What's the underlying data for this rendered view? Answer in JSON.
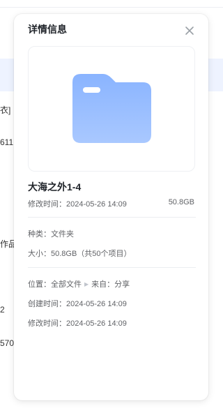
{
  "background": {
    "fragments": [
      "衣]",
      "611",
      "作品",
      "2",
      "570"
    ]
  },
  "panel": {
    "title": "详情信息",
    "file_name": "大海之外1-4",
    "modified_label": "修改时间：",
    "modified_value": "2024-05-26 14:09",
    "size_short": "50.8GB",
    "type_label": "种类：",
    "type_value": "文件夹",
    "size_label": "大小：",
    "size_value": "50.8GB（共50个项目）",
    "location_label": "位置：",
    "location_value": "全部文件",
    "source_label": "来自：",
    "source_value": "分享",
    "created_label": "创建时间：",
    "created_value": "2024-05-26 14:09",
    "modified2_label": "修改时间：",
    "modified2_value": "2024-05-26 14:09"
  },
  "icons": {
    "close": "close-icon",
    "folder": "folder-icon",
    "separator": "chevron-right-icon"
  },
  "colors": {
    "folder_top": "#8ab4ff",
    "folder_bottom": "#a9c8ff"
  }
}
